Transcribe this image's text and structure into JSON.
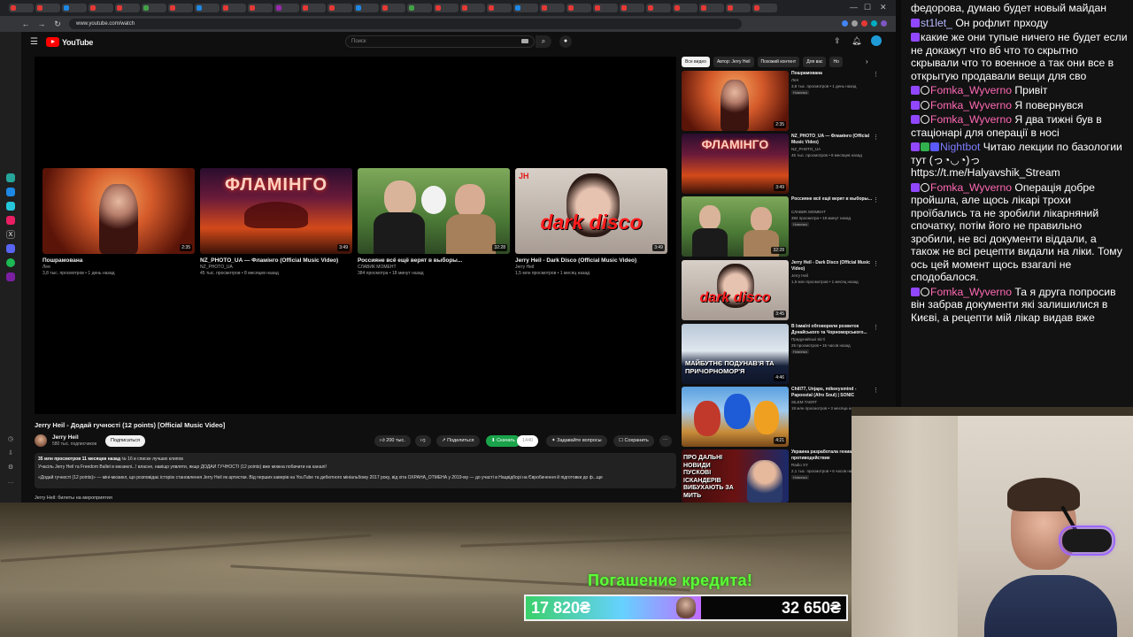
{
  "browser": {
    "url": "www.youtube.com/watch",
    "tab_colors": [
      "#e53935",
      "#e53935",
      "#1e88e5",
      "#e53935",
      "#e53935",
      "#43a047",
      "#e53935",
      "#1e88e5",
      "#e53935",
      "#e53935",
      "#9c27b0",
      "#e53935",
      "#e53935",
      "#1e88e5",
      "#e53935",
      "#43a047",
      "#e53935",
      "#e53935",
      "#e53935",
      "#1e88e5",
      "#e53935",
      "#e53935",
      "#e53935",
      "#e53935",
      "#e53935",
      "#e53935",
      "#e53935",
      "#e53935",
      "#e53935"
    ]
  },
  "youtube": {
    "logo": "YouTube",
    "search_placeholder": "Поиск",
    "video_title": "Jerry Heil - Додай гучності (12 points) [Official Music Video]",
    "channel_name": "Jerry Heil",
    "channel_subs": "580 тыс. подписчиков",
    "subscribe_label": "Подписаться",
    "like_count": "200 тыс.",
    "share_label": "Поделиться",
    "download_label": "Скачать",
    "download_badge": "1440",
    "ask_label": "Задавайте вопросы",
    "save_label": "Сохранить",
    "desc_stats": "35 млн просмотров  11 месяцев назад",
    "desc_rank": "№ 16 в списке лучших клипов",
    "desc_line1": "Учасіль Jerry Heil та Freedom Ballet в мюзиклі...! власне, навіщо уявляти, якщо ДОДАЙ ГУЧНОСТІ (12 points) вже можна побачити на каналі!",
    "desc_line2": "«Додай гучності (12 points)» — міні-мюзикл, що розповідає історію становлення Jerry Heil як артистки. Від перших каверів на YouTube та дебютного мініальбому 2017 року, від хіта ОХРАНА_ОТМЕНА у 2019-му — до участі в Нацвідборі на Євробачення й підготовки до ф...ще",
    "link_line": "Jerry Heil: билеты на мероприятия",
    "endcards": [
      {
        "title": "Пошрамована",
        "channel": "Лея",
        "meta": "3,8 тыс. просмотров • 1 день назад",
        "duration": "2:35"
      },
      {
        "title": "NZ_PHOTO_UA — Фламінго (Official Music Video)",
        "channel": "NZ_PHOTO_UA",
        "meta": "45 тыс. просмотров • 8 месяцев назад",
        "duration": "3:49"
      },
      {
        "title": "Россияне всё ещё верят в выборы...",
        "channel": "СЛАВИК МОМЕНТ",
        "meta": "384 просмотра • 18 минут назад",
        "duration": "32:28"
      },
      {
        "title": "Jerry Heil - Dark Disco (Official Music Video)",
        "channel": "Jerry Heil",
        "meta": "1,5 млн просмотров • 1 месяц назад",
        "duration": "3:49"
      }
    ],
    "chips": [
      "Все видео",
      "Автор: Jerry Heil",
      "Похожий контент",
      "Для вас",
      "Но"
    ],
    "recommendations": [
      {
        "title": "Пошрамована",
        "channel": "Лея",
        "meta": "3,8 тыс. просмотров • 1 день назад",
        "badge": "Новинка",
        "duration": "2:35"
      },
      {
        "title": "NZ_PHOTO_UA — Фламінго (Official Music Video)",
        "channel": "NZ_PHOTO_UA",
        "meta": "45 тыс. просмотров • 8 месяцев назад",
        "badge": "",
        "duration": "3:49"
      },
      {
        "title": "Россияне всё ещё верят в выборы...",
        "channel": "СЛАВИК МОМЕНТ",
        "meta": "384 просмотра • 18 минут назад",
        "badge": "Новинка",
        "duration": "32:28"
      },
      {
        "title": "Jerry Heil - Dark Disco (Official Music Video)",
        "channel": "Jerry Heil",
        "meta": "1,5 млн просмотров • 1 месяц назад",
        "badge": "",
        "duration": "3:45"
      },
      {
        "title": "В Ізмаїлі обговорили розвиток Дунайського та Чорноморського...",
        "channel": "Придунайські вісті",
        "meta": "25 просмотров • 15 часов назад",
        "badge": "Новинка",
        "duration": "4:46"
      },
      {
        "title": "Chill77, Unjaps, mikeeysmind - Papoostal (Afro Soul) | SONIC",
        "channel": "SILEM TAERT",
        "meta": "18 млн просмотров • 3 месяца назад",
        "badge": "",
        "duration": "4:21"
      },
      {
        "title": "Украина разработала гениально противодействие",
        "channel": "Radio XY",
        "meta": "2,1 тыс. просмотров • 6 часов назад",
        "badge": "Новинка",
        "duration": ""
      }
    ],
    "rec_overlays": {
      "rec4_caption": "МАЙБУТНЄ ПОДУНАВ'Я ТА ПРИЧОРНОМОР'Я",
      "rec6_caption": "ПРО ДАЛЬНІ НОВИДИ ПУСКОВІ ІСКАНДЕРІВ ВИБУХАЮТЬ ЗА МИТЬ",
      "endcard2_text": "ФЛАМІНГО",
      "endcard4_text": "dark disco"
    }
  },
  "chat": [
    {
      "user": "",
      "user_color": "#ffffff",
      "text": "федорова, думаю будет новый майдан",
      "badges": []
    },
    {
      "user": "st1let_",
      "user_color": "#b6b9ff",
      "text": "Он рофлит прходу",
      "badges": [
        "#9147ff"
      ]
    },
    {
      "user": "",
      "user_color": "#ffffff",
      "text": "какие же они тупые ничего не будет если не докажут что вб что то скрытно скрывали что то военное а так они все в открытую продавали вещи для сво",
      "badges": [
        "#9147ff"
      ]
    },
    {
      "user": "Fomka_Wyverno",
      "user_color": "#ff69b4",
      "text": "Привіт",
      "badges": [
        "#9147ff",
        "circle"
      ]
    },
    {
      "user": "Fomka_Wyverno",
      "user_color": "#ff69b4",
      "text": "Я повернувся",
      "badges": [
        "#9147ff",
        "circle"
      ]
    },
    {
      "user": "Fomka_Wyverno",
      "user_color": "#ff69b4",
      "text": "Я два тижні був в стаціонарі для операції в носі",
      "badges": [
        "#9147ff",
        "circle"
      ]
    },
    {
      "user": "Nightbot",
      "user_color": "#7c7cff",
      "text": "Читаю лекции по базологии тут (っ◔◡◔)っ https://t.me/Halyavshik_Stream",
      "badges": [
        "#9147ff",
        "#31b24f",
        "#5a5aff"
      ]
    },
    {
      "user": "Fomka_Wyverno",
      "user_color": "#ff69b4",
      "text": "Операція добре пройшла, але щось лікарі трохи проїбались та не зробили лікарняний спочатку, потім його не правильно зробили, не всі документи віддали, а також не всі рецепти видали на ліки. Тому ось цей момент щось взагалі не сподобалося.",
      "badges": [
        "#9147ff",
        "circle"
      ]
    },
    {
      "user": "Fomka_Wyverno",
      "user_color": "#ff69b4",
      "text": "Та я друга попросив він забрав документи які залишилися в Києві, а рецепти мій лікар видав вже",
      "badges": [
        "#9147ff",
        "circle"
      ]
    }
  ],
  "overlay": {
    "loan_title": "Погашение кредита!",
    "loan_current": "17 820₴",
    "loan_target": "32 650₴",
    "loan_progress": 0.546,
    "accent": "#59ff36"
  }
}
